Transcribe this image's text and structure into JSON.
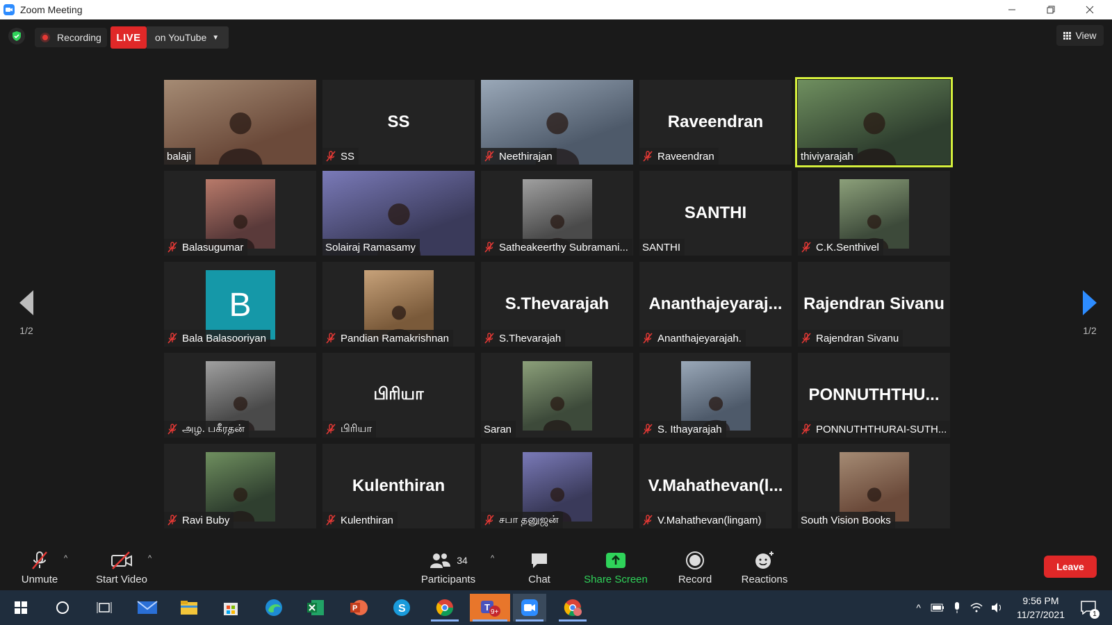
{
  "window": {
    "title": "Zoom Meeting",
    "controls": [
      "minimize",
      "restore",
      "close"
    ]
  },
  "topbar": {
    "recording_label": "Recording",
    "live_label": "LIVE",
    "live_destination": "on YouTube",
    "view_label": "View"
  },
  "gallery": {
    "page_left": "1/2",
    "page_right": "1/2",
    "tiles": [
      {
        "name": "balaji",
        "display": "",
        "muted": false,
        "video": true,
        "active": false
      },
      {
        "name": "SS",
        "display": "SS",
        "muted": true,
        "video": false,
        "active": false
      },
      {
        "name": "Neethirajan",
        "display": "",
        "muted": true,
        "video": true,
        "active": false
      },
      {
        "name": "Raveendran",
        "display": "Raveendran",
        "muted": true,
        "video": false,
        "active": false
      },
      {
        "name": "thiviyarajah",
        "display": "",
        "muted": false,
        "video": true,
        "active": true
      },
      {
        "name": "Balasugumar",
        "display": "",
        "muted": true,
        "video": true,
        "active": false
      },
      {
        "name": "Solairaj Ramasamy",
        "display": "",
        "muted": false,
        "video": true,
        "active": false
      },
      {
        "name": "Satheakeerthy Subramani...",
        "display": "",
        "muted": true,
        "video": true,
        "active": false
      },
      {
        "name": "SANTHI",
        "display": "SANTHI",
        "muted": false,
        "video": false,
        "active": false
      },
      {
        "name": "C.K.Senthivel",
        "display": "",
        "muted": true,
        "video": true,
        "active": false
      },
      {
        "name": "Bala Balasooriyan",
        "display": "",
        "avatar_letter": "B",
        "muted": true,
        "video": true,
        "active": false
      },
      {
        "name": "Pandian Ramakrishnan",
        "display": "",
        "muted": true,
        "video": true,
        "active": false
      },
      {
        "name": "S.Thevarajah",
        "display": "S.Thevarajah",
        "muted": true,
        "video": false,
        "active": false
      },
      {
        "name": "Ananthajeyarajah.",
        "display": "Ananthajeyaraj...",
        "muted": true,
        "video": false,
        "active": false
      },
      {
        "name": "Rajendran Sivanu",
        "display": "Rajendran Sivanu",
        "muted": true,
        "video": false,
        "active": false
      },
      {
        "name": "அழ. பகீரதன்",
        "display": "",
        "muted": true,
        "video": true,
        "active": false
      },
      {
        "name": "பிரியா",
        "display": "பிரியா",
        "muted": true,
        "video": false,
        "active": false
      },
      {
        "name": "Saran",
        "display": "",
        "muted": false,
        "video": true,
        "active": false
      },
      {
        "name": "S. Ithayarajah",
        "display": "",
        "muted": true,
        "video": true,
        "active": false
      },
      {
        "name": "PONNUTHTHURAI-SUTH...",
        "display": "PONNUTHTHU...",
        "muted": true,
        "video": false,
        "active": false
      },
      {
        "name": "Ravi Buby",
        "display": "",
        "muted": true,
        "video": true,
        "active": false
      },
      {
        "name": "Kulenthiran",
        "display": "Kulenthiran",
        "muted": true,
        "video": false,
        "active": false
      },
      {
        "name": "சபா தனுஜன்",
        "display": "",
        "muted": true,
        "video": true,
        "active": false
      },
      {
        "name": "V.Mahathevan(lingam)",
        "display": "V.Mahathevan(l...",
        "muted": true,
        "video": false,
        "active": false
      },
      {
        "name": "South Vision Books",
        "display": "",
        "muted": false,
        "video": true,
        "active": false
      }
    ]
  },
  "toolbar": {
    "unmute": "Unmute",
    "start_video": "Start Video",
    "participants": "Participants",
    "participants_count": "34",
    "chat": "Chat",
    "share_screen": "Share Screen",
    "record": "Record",
    "reactions": "Reactions",
    "leave": "Leave"
  },
  "taskbar": {
    "time": "9:56 PM",
    "date": "11/27/2021",
    "teams_badge": "9+",
    "notification_count": "1"
  },
  "colors": {
    "accent_live": "#e02828",
    "share_green": "#2fd35a",
    "active_speaker": "#d4ef3c",
    "zoom_blue": "#2d8cff"
  }
}
